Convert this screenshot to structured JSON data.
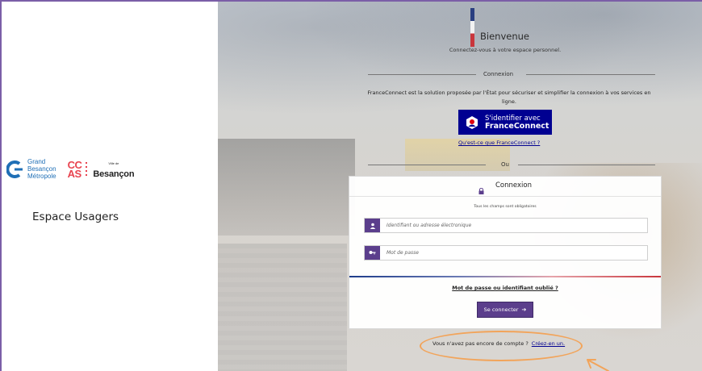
{
  "branding": {
    "gbm_line1": "Grand",
    "gbm_line2": "Besançon",
    "gbm_line3": "Métropole",
    "ccas_line1": "CC",
    "ccas_line2": "AS",
    "ville_small": "Ville de",
    "ville_name": "Besançon"
  },
  "left": {
    "title": "Espace Usagers"
  },
  "welcome": {
    "title": "Bienvenue",
    "subtitle": "Connectez-vous à votre espace personnel."
  },
  "franceconnect": {
    "section_label": "Connexion",
    "description": "FranceConnect est la solution proposée par l'État pour sécuriser et simplifier la connexion à vos services en ligne.",
    "button_line1": "S'identifier avec",
    "button_line2": "FranceConnect",
    "info_link": "Qu'est-ce que FranceConnect ?"
  },
  "divider": {
    "label": "Ou"
  },
  "login_card": {
    "title": "Connexion",
    "required_note": "Tous les champs sont obligatoires",
    "username_placeholder": "Identifiant ou adresse électronique",
    "password_placeholder": "Mot de passe",
    "forgot_link": "Mot de passe ou identifiant oublié ?",
    "submit_label": "Se connecter"
  },
  "signup": {
    "prompt": "Vous n'avez pas encore de compte ?",
    "link": "Créez-en un."
  },
  "colors": {
    "accent_purple": "#5b3e8c",
    "franceconnect_blue": "#000091",
    "ccas_red": "#e8434f",
    "gbm_blue": "#1f6fb6",
    "highlight_orange": "#f2a45a"
  }
}
